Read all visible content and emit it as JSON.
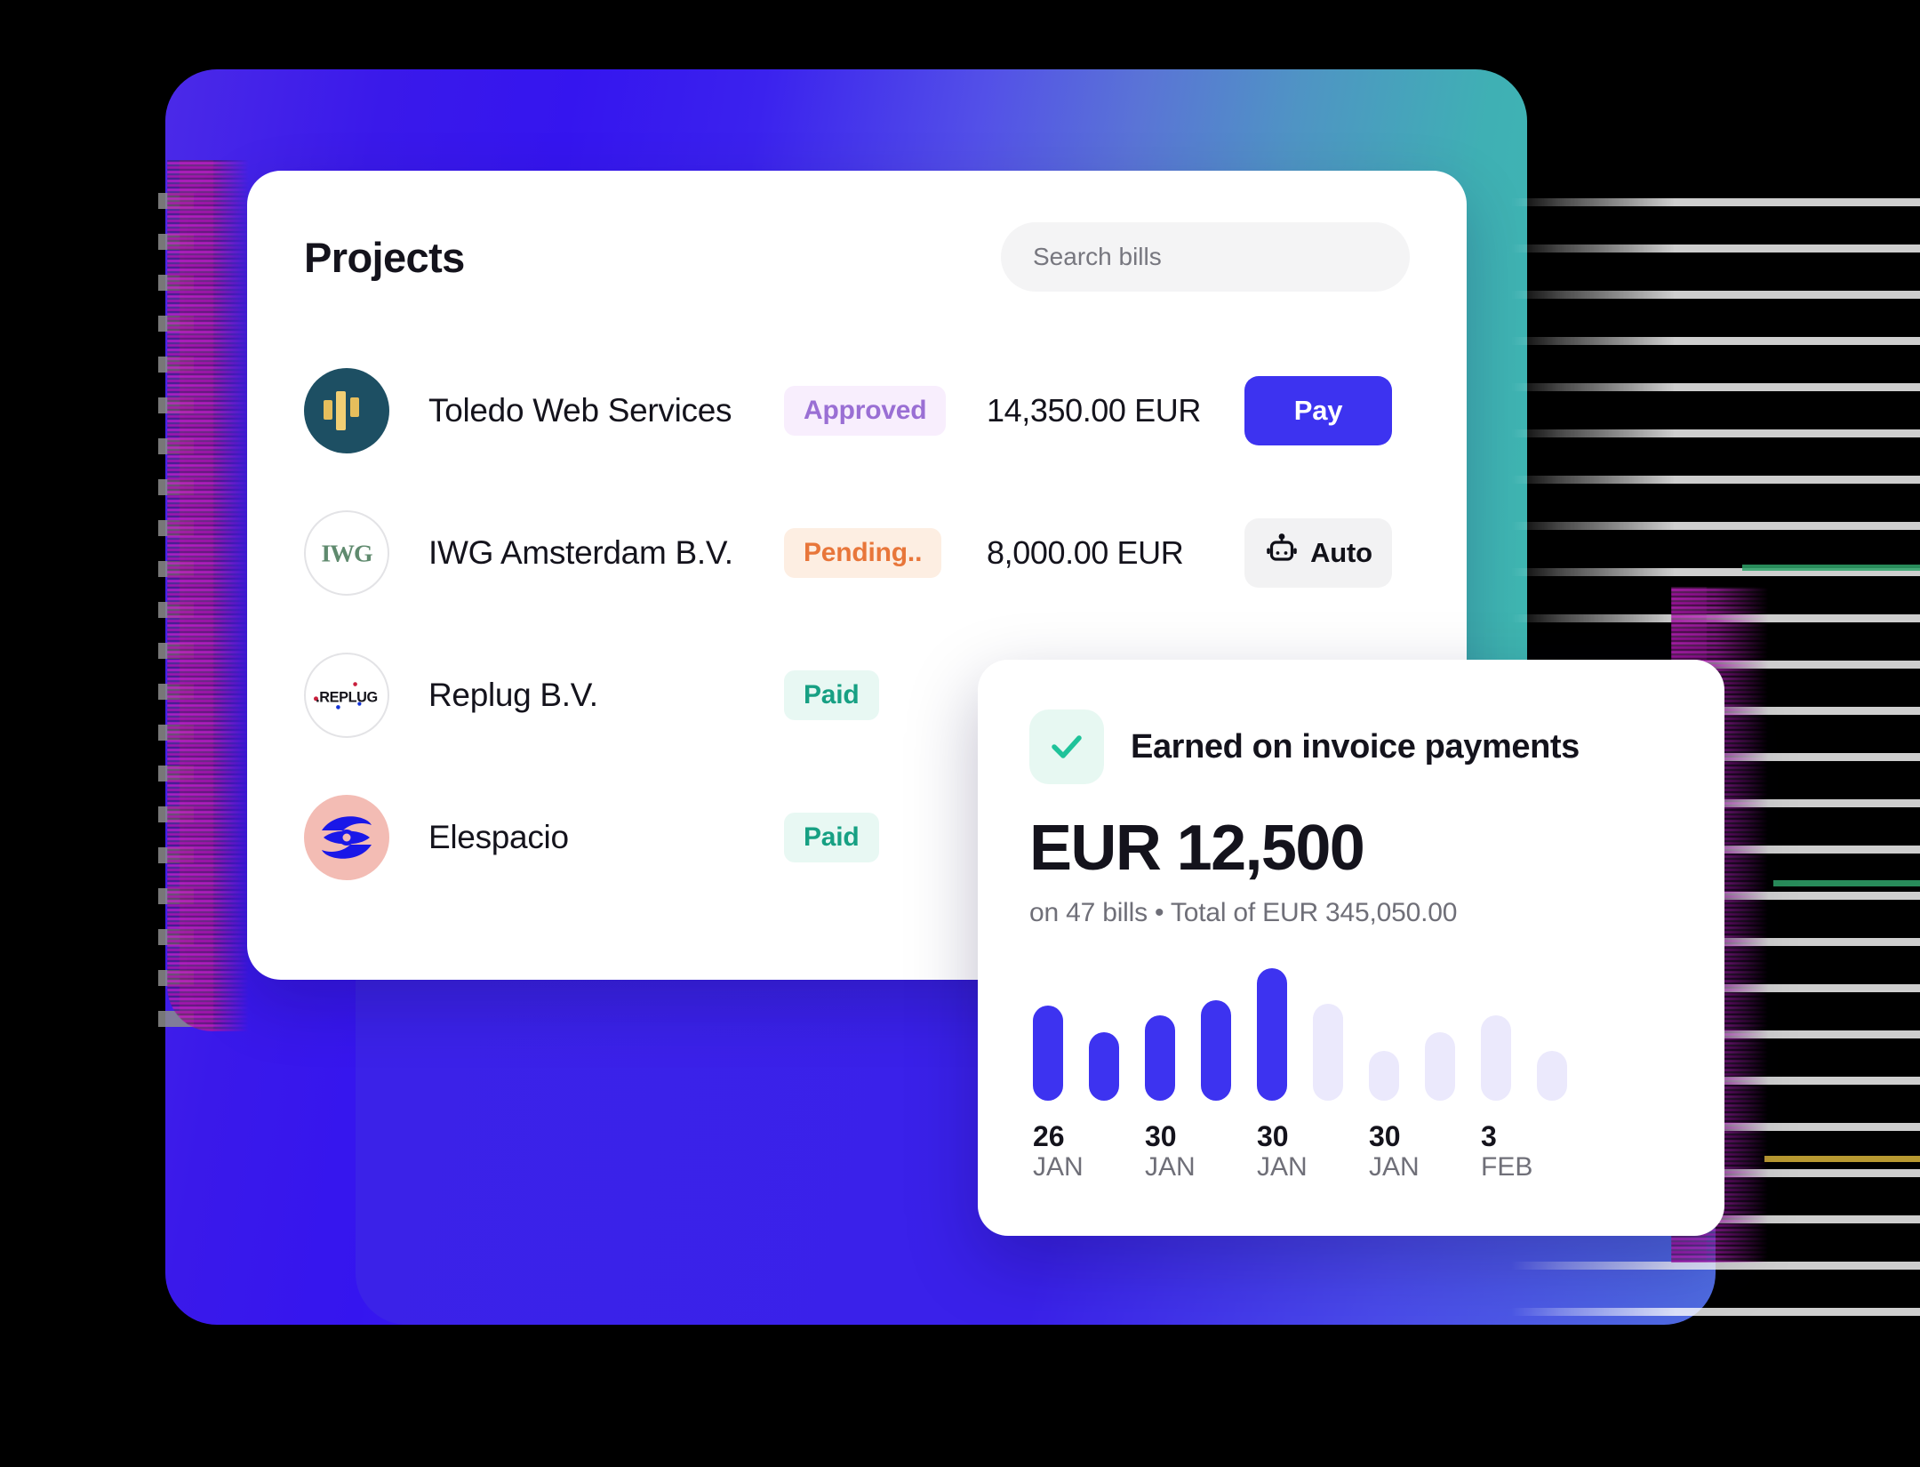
{
  "colors": {
    "brand_blue": "#3d33f0",
    "gradient_start": "#4b2ae8",
    "gradient_mid": "#5350e8",
    "gradient_end": "#3fbdb0",
    "paid_text": "#17a083",
    "paid_bg": "#e8f8f3",
    "approved_text": "#9a6fd4",
    "approved_bg": "#f8eefd",
    "pending_text": "#e8763a",
    "pending_bg": "#fdeee2",
    "check_teal": "#1fc39a"
  },
  "panel": {
    "title": "Projects",
    "search": {
      "placeholder": "Search bills",
      "value": ""
    },
    "rows": [
      {
        "name": "Toledo Web Services",
        "status": "Approved",
        "status_kind": "approved",
        "amount": "14,350.00 EUR",
        "action": "Pay",
        "action_kind": "pay",
        "avatar": "toledo-bars-logo"
      },
      {
        "name": "IWG Amsterdam B.V.",
        "status": "Pending..",
        "status_kind": "pending",
        "amount": "8,000.00 EUR",
        "action": "Auto",
        "action_kind": "auto",
        "avatar": "iwg-logo"
      },
      {
        "name": "Replug B.V.",
        "status": "Paid",
        "status_kind": "paid",
        "amount": "",
        "action": "",
        "action_kind": "none",
        "avatar": "replug-logo"
      },
      {
        "name": "Elespacio",
        "status": "Paid",
        "status_kind": "paid",
        "amount": "",
        "action": "",
        "action_kind": "none",
        "avatar": "elespacio-eye-logo"
      }
    ]
  },
  "earnings_card": {
    "icon": "check-icon",
    "title": "Earned on invoice payments",
    "amount": "EUR 12,500",
    "subtitle": "on 47 bills • Total of EUR 345,050.00"
  },
  "chart_data": {
    "type": "bar",
    "title": "Earned on invoice payments",
    "xlabel": "",
    "ylabel": "",
    "grid": false,
    "legend": "none",
    "ylim": [
      0,
      120
    ],
    "categories": [
      "26 JAN",
      "",
      "30 JAN",
      "",
      "30 JAN",
      "",
      "30 JAN",
      "",
      "3 FEB",
      ""
    ],
    "values": [
      80,
      58,
      72,
      85,
      112,
      82,
      42,
      58,
      72,
      42
    ],
    "bar_states": [
      "active",
      "active",
      "active",
      "active",
      "active",
      "muted",
      "muted",
      "muted",
      "muted",
      "muted"
    ],
    "colors": {
      "active": "#3d33f0",
      "muted": "#ebe9fc"
    },
    "tick_labels": [
      {
        "day": "26",
        "month": "JAN"
      },
      {
        "day": "30",
        "month": "JAN"
      },
      {
        "day": "30",
        "month": "JAN"
      },
      {
        "day": "30",
        "month": "JAN"
      },
      {
        "day": "3",
        "month": "FEB"
      }
    ]
  }
}
